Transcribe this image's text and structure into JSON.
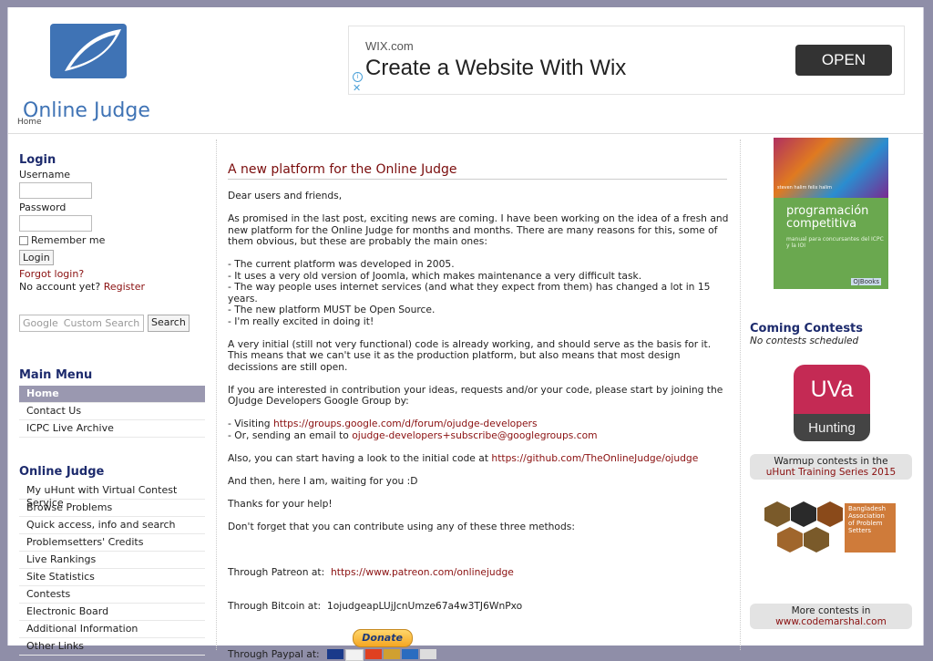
{
  "header": {
    "logo_text": "Online Judge",
    "breadcrumb": "Home"
  },
  "ad": {
    "domain": "WIX.com",
    "headline": "Create a Website With Wix",
    "button": "OPEN",
    "info_icon": "i",
    "close_icon": "✕"
  },
  "login": {
    "title": "Login",
    "username_label": "Username",
    "password_label": "Password",
    "remember_label": "Remember me",
    "login_button": "Login",
    "forgot": "Forgot login?",
    "no_account": "No account yet?",
    "register": "Register"
  },
  "search": {
    "google": "Google",
    "placeholder": "Custom Search",
    "button": "Search"
  },
  "main_menu": {
    "title": "Main Menu",
    "items": [
      "Home",
      "Contact Us",
      "ICPC Live Archive"
    ]
  },
  "oj_menu": {
    "title": "Online Judge",
    "items": [
      "My uHunt with Virtual Contest Service",
      "Browse Problems",
      "Quick access, info and search",
      "Problemsetters' Credits",
      "Live Rankings",
      "Site Statistics",
      "Contests",
      "Electronic Board",
      "Additional Information",
      "Other Links"
    ]
  },
  "article": {
    "title": "A new platform for the Online Judge",
    "greeting": "Dear users and friends,",
    "p1": "As promised in the last post, exciting news are coming. I have been working on the idea of a fresh and new platform for the Online Judge for months and months. There are many reasons for this, some of them obvious, but these are probably the main ones:",
    "reasons": [
      "- The current platform was developed in 2005.",
      "- It uses a very old version of Joomla, which makes maintenance a very difficult task.",
      "- The way people uses internet services (and what they expect from them) has changed a lot in 15 years.",
      "- The new platform MUST be Open Source.",
      "- I'm really excited in doing it!"
    ],
    "p2": "A very initial (still not very functional) code is already working, and should serve as the basis for it. This means that we can't use it as the production platform, but also means that most design decissions are still open.",
    "p3": "If you are interested in contribution your ideas, requests and/or your code, please start by joining the OJudge Developers Google Group by:",
    "visit_prefix": "- Visiting ",
    "visit_link": "https://groups.google.com/d/forum/ojudge-developers",
    "email_prefix": "- Or, sending an email to ",
    "email_link": "ojudge-developers+subscribe@googlegroups.com",
    "github_prefix": "Also, you can start having a look to the initial code at ",
    "github_link": "https://github.com/TheOnlineJudge/ojudge",
    "waiting": "And then, here I am, waiting for you :D",
    "thanks": "Thanks for your help!",
    "contribute": "Don't forget that you can contribute using any of these three methods:",
    "patreon_label": "Through Patreon at:",
    "patreon_link": "https://www.patreon.com/onlinejudge",
    "bitcoin_label": "Through Bitcoin at:",
    "bitcoin_addr": "1ojudgeapLUjJcnUmze67a4w3TJ6WnPxo",
    "paypal_label": "Through Paypal at:",
    "donate_button": "Donate"
  },
  "right": {
    "book": {
      "title": "programación competitiva",
      "subtitle": "manual para concursantes del ICPC y la IOI",
      "authors": "steven halim felix halim",
      "publisher": "OJBooks"
    },
    "coming_title": "Coming Contests",
    "no_contests": "No contests scheduled",
    "uva_top": "UVa",
    "uva_bottom": "Hunting",
    "warmup_line1": "Warmup contests in the",
    "warmup_link": "uHunt Training Series 2015",
    "baps_text": "Bangladesh Association of Problem Setters",
    "more_line1": "More contests in",
    "more_link": "www.codemarshal.com"
  }
}
